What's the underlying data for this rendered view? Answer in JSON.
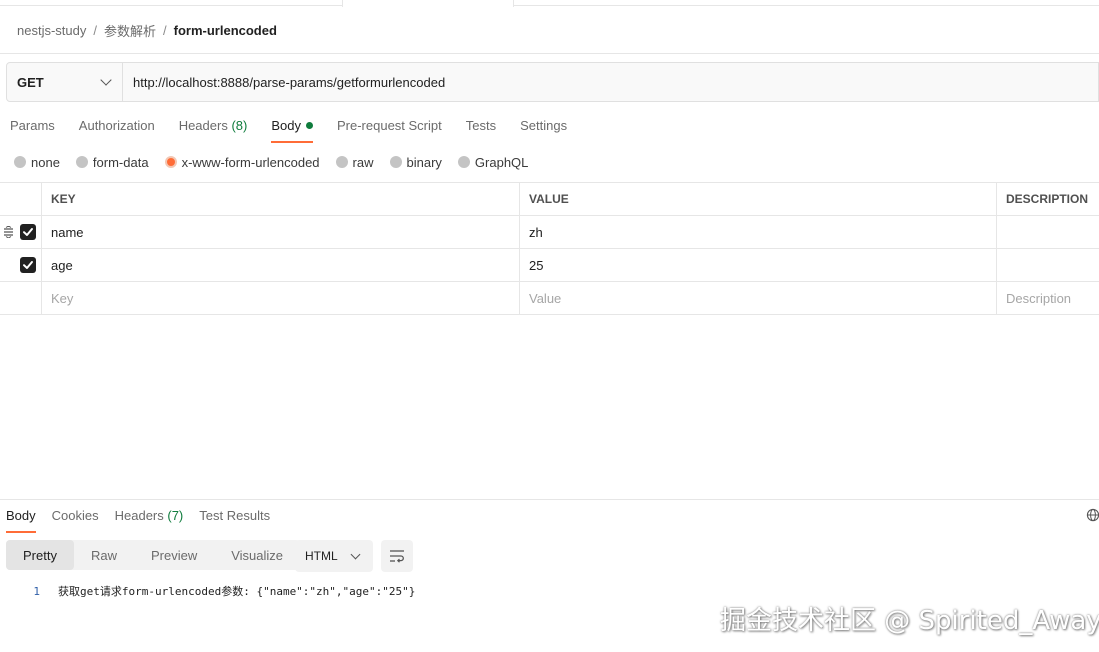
{
  "breadcrumb": {
    "collection": "nestjs-study",
    "folder": "参数解析",
    "request": "form-urlencoded",
    "separator": "/"
  },
  "request": {
    "method": "GET",
    "url": "http://localhost:8888/parse-params/getformurlencoded"
  },
  "request_tabs": {
    "params": "Params",
    "authorization": "Authorization",
    "headers": "Headers",
    "headers_count": "(8)",
    "body": "Body",
    "pre_request": "Pre-request Script",
    "tests": "Tests",
    "settings": "Settings"
  },
  "body_types": {
    "none": "none",
    "form_data": "form-data",
    "urlencoded": "x-www-form-urlencoded",
    "raw": "raw",
    "binary": "binary",
    "graphql": "GraphQL",
    "selected": "x-www-form-urlencoded"
  },
  "kv_table": {
    "headers": {
      "key": "KEY",
      "value": "VALUE",
      "description": "DESCRIPTION"
    },
    "rows": [
      {
        "key": "name",
        "value": "zh",
        "description": "",
        "checked": true
      },
      {
        "key": "age",
        "value": "25",
        "description": "",
        "checked": true
      }
    ],
    "placeholders": {
      "key": "Key",
      "value": "Value",
      "description": "Description"
    }
  },
  "response_tabs": {
    "body": "Body",
    "cookies": "Cookies",
    "headers": "Headers",
    "headers_count": "(7)",
    "test_results": "Test Results"
  },
  "response_view": {
    "pretty": "Pretty",
    "raw": "Raw",
    "preview": "Preview",
    "visualize": "Visualize",
    "format": "HTML"
  },
  "response_body": {
    "line_number": "1",
    "content": "获取get请求form-urlencoded参数: {\"name\":\"zh\",\"age\":\"25\"}"
  },
  "watermark": "掘金技术社区 @ Spirited_Away",
  "colors": {
    "accent": "#ff6c37",
    "count_green": "#0f7c3d"
  }
}
